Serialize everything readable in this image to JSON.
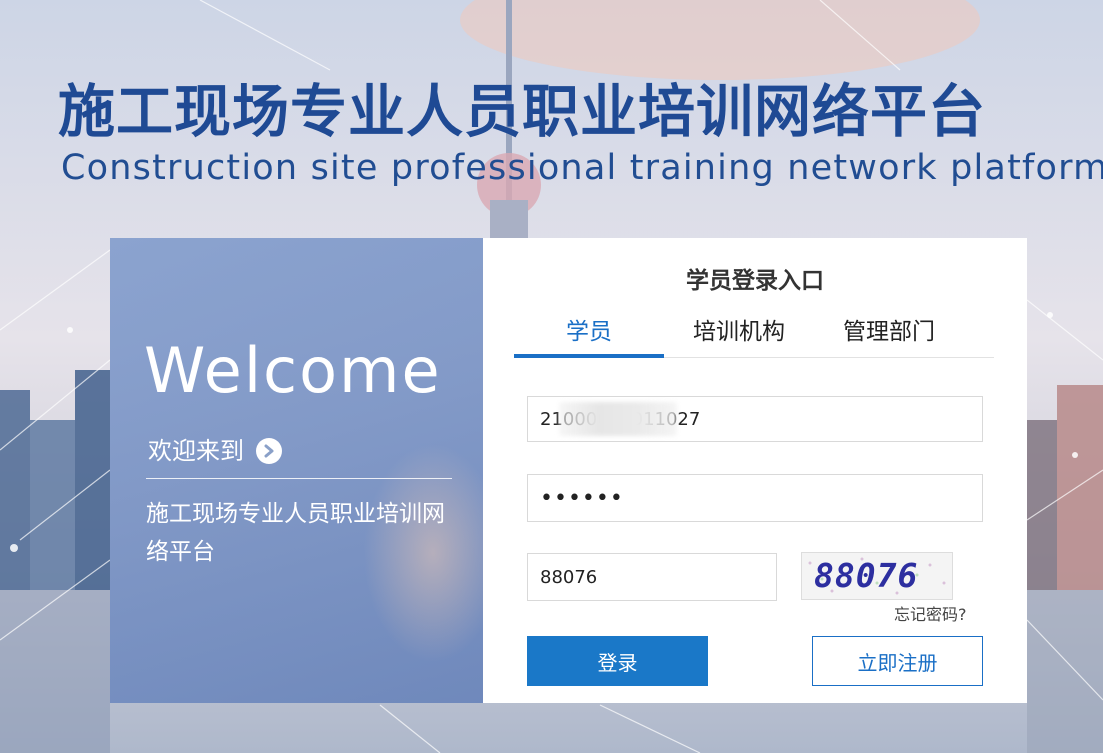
{
  "header": {
    "title_cn": "施工现场专业人员职业培训网络平台",
    "title_en": "Construction site professional training network platform"
  },
  "welcome_panel": {
    "welcome": "Welcome",
    "welcome_to": "欢迎来到",
    "arrow_icon": "arrow-right-circle-icon",
    "platform_name": "施工现场专业人员职业培训网络平台"
  },
  "login": {
    "title": "学员登录入口",
    "tabs": [
      {
        "label": "学员",
        "active": true
      },
      {
        "label": "培训机构",
        "active": false
      },
      {
        "label": "管理部门",
        "active": false
      }
    ],
    "username_value": "21000000011027",
    "password_value": "••••••",
    "captcha_value": "88076",
    "captcha_image_text": "88076",
    "forgot_label": "忘记密码?",
    "login_label": "登录",
    "register_label": "立即注册"
  },
  "colors": {
    "accent": "#1a78c8",
    "title": "#1f4a94"
  }
}
